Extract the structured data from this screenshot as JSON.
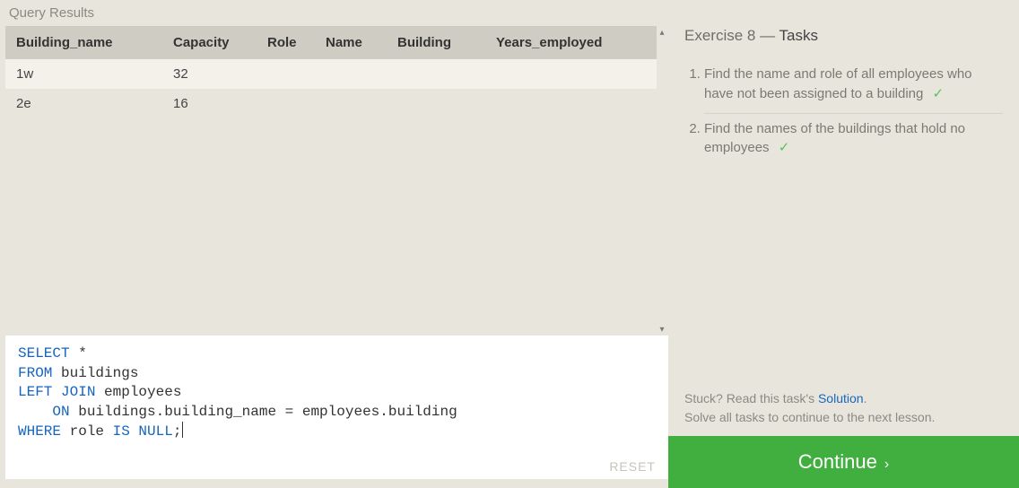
{
  "left": {
    "title": "Query Results",
    "columns": [
      "Building_name",
      "Capacity",
      "Role",
      "Name",
      "Building",
      "Years_employed"
    ],
    "rows": [
      {
        "Building_name": "1w",
        "Capacity": "32",
        "Role": "",
        "Name": "",
        "Building": "",
        "Years_employed": ""
      },
      {
        "Building_name": "2e",
        "Capacity": "16",
        "Role": "",
        "Name": "",
        "Building": "",
        "Years_employed": ""
      }
    ],
    "reset": "RESET",
    "code_tokens": [
      {
        "t": "SELECT",
        "kw": true
      },
      {
        "t": " *\n"
      },
      {
        "t": "FROM",
        "kw": true
      },
      {
        "t": " buildings\n"
      },
      {
        "t": "LEFT JOIN",
        "kw": true
      },
      {
        "t": " employees\n    "
      },
      {
        "t": "ON",
        "kw": true
      },
      {
        "t": " buildings.building_name = employees.building\n"
      },
      {
        "t": "WHERE",
        "kw": true
      },
      {
        "t": " role "
      },
      {
        "t": "IS NULL",
        "kw": true
      },
      {
        "t": ";"
      }
    ]
  },
  "right": {
    "exercise_prefix": "Exercise 8 — ",
    "exercise_word": "Tasks",
    "tasks": [
      {
        "text": "Find the name and role of all employees who have not been assigned to a building",
        "done": true
      },
      {
        "text": "Find the names of the buildings that hold no employees",
        "done": true
      }
    ],
    "hint_prefix": "Stuck? Read this task's ",
    "hint_link": "Solution",
    "hint_suffix": ".",
    "hint_line2": "Solve all tasks to continue to the next lesson.",
    "continue": "Continue"
  }
}
